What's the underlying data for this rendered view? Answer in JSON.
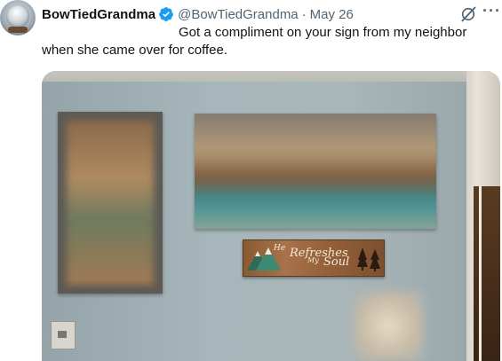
{
  "tweet": {
    "display_name": "BowTiedGrandma",
    "handle": "@BowTiedGrandma",
    "separator": "·",
    "date": "May 26",
    "text": "Got a compliment on your sign from my neighbor when she came over for coffee.",
    "verified_color": "#1d9bf0"
  },
  "actions": {
    "grok_icon": "grok-icon",
    "more_label": "···"
  },
  "media": {
    "sign_words": [
      "He",
      "Refreshes",
      "My",
      "Soul"
    ]
  }
}
